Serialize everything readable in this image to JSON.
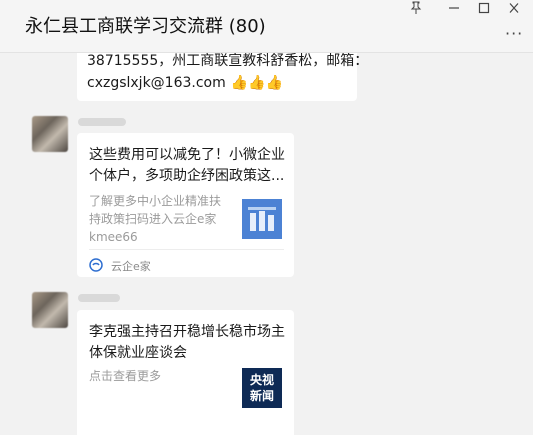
{
  "window": {
    "title": "永仁县工商联学习交流群 (80)",
    "pin_icon": "pin-icon",
    "minimize_icon": "minimize-icon",
    "maximize_icon": "maximize-icon",
    "close_icon": "close-icon",
    "more_icon": "more-icon",
    "more_glyph": "···"
  },
  "messages": [
    {
      "type": "text",
      "line1": "38715555，州工商联宣教科舒香松，邮箱：",
      "line2": "cxzgslxjk@163.com",
      "emoji": "👍👍👍"
    },
    {
      "type": "link-card",
      "title_line1": "这些费用可以减免了！小微企业",
      "title_line2": "个体户，多项助企纾困政策这...",
      "desc_line1": "了解更多中小企业精准扶",
      "desc_line2": "持政策扫码进入云企e家",
      "desc_line3": "kmee66",
      "source": "云企e家"
    },
    {
      "type": "link-card",
      "title_line1": "李克强主持召开稳增长稳市场主",
      "title_line2": "体保就业座谈会",
      "desc_line1": "点击查看更多",
      "logo_line1": "央视",
      "logo_line2": "新闻"
    }
  ]
}
